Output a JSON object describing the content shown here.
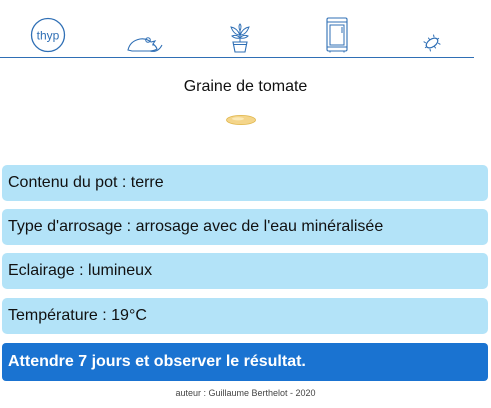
{
  "nav": {
    "items": [
      {
        "name": "thyp-logo",
        "label": "thyp"
      },
      {
        "name": "mouse-icon"
      },
      {
        "name": "plant-icon"
      },
      {
        "name": "fridge-icon"
      },
      {
        "name": "bacteria-icon"
      }
    ]
  },
  "experiment": {
    "title": "Graine de tomate",
    "seed_icon": "seed-icon"
  },
  "conditions": [
    {
      "label": "Contenu du pot : terre"
    },
    {
      "label": "Type d'arrosage : arrosage avec de l'eau minéralisée"
    },
    {
      "label": "Eclairage : lumineux"
    },
    {
      "label": "Température : 19°C"
    }
  ],
  "action": {
    "label": "Attendre 7 jours et observer le résultat."
  },
  "footer": {
    "text": "auteur : Guillaume Berthelot - 2020"
  },
  "colors": {
    "accent": "#1a73d1",
    "card": "#b3e3f8",
    "nav_stroke": "#2f6fb5"
  }
}
